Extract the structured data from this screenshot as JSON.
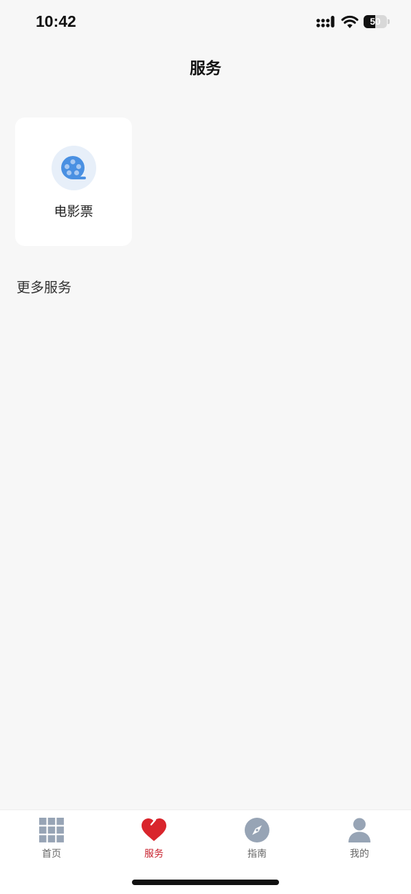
{
  "status_bar": {
    "time": "10:42",
    "battery_level": "50",
    "battery_percent": 50,
    "icons": [
      "signal-icon",
      "wifi-icon",
      "battery-icon"
    ]
  },
  "nav": {
    "title": "服务"
  },
  "services": [
    {
      "label": "电影票",
      "icon": "film-reel-icon",
      "icon_color": "#4a90e2"
    }
  ],
  "more_services": {
    "title": "更多服务"
  },
  "tab_bar": {
    "active_color": "#c8202c",
    "inactive_color": "#97a4b5",
    "items": [
      {
        "label": "首页",
        "icon": "grid-icon",
        "active": false
      },
      {
        "label": "服务",
        "icon": "heart-icon",
        "active": true
      },
      {
        "label": "指南",
        "icon": "compass-icon",
        "active": false
      },
      {
        "label": "我的",
        "icon": "user-icon",
        "active": false
      }
    ]
  }
}
